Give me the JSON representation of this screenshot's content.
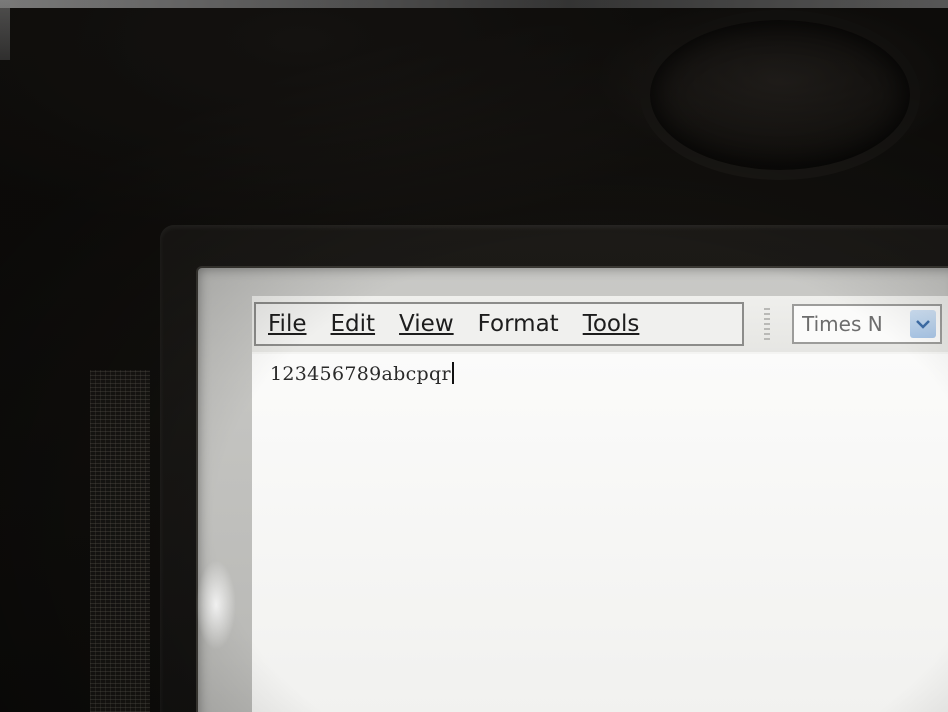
{
  "app": {
    "menu": [
      {
        "label": "File"
      },
      {
        "label": "Edit"
      },
      {
        "label": "View"
      },
      {
        "label": "Format"
      },
      {
        "label": "Tools"
      }
    ],
    "font_selector": {
      "value": "Times N",
      "icon": "chevron-down-icon"
    },
    "document": {
      "text": "123456789abcpqr"
    }
  },
  "colors": {
    "screen_bg": "#f4f4f2",
    "dropdown_accent": "#a9c6e6"
  }
}
